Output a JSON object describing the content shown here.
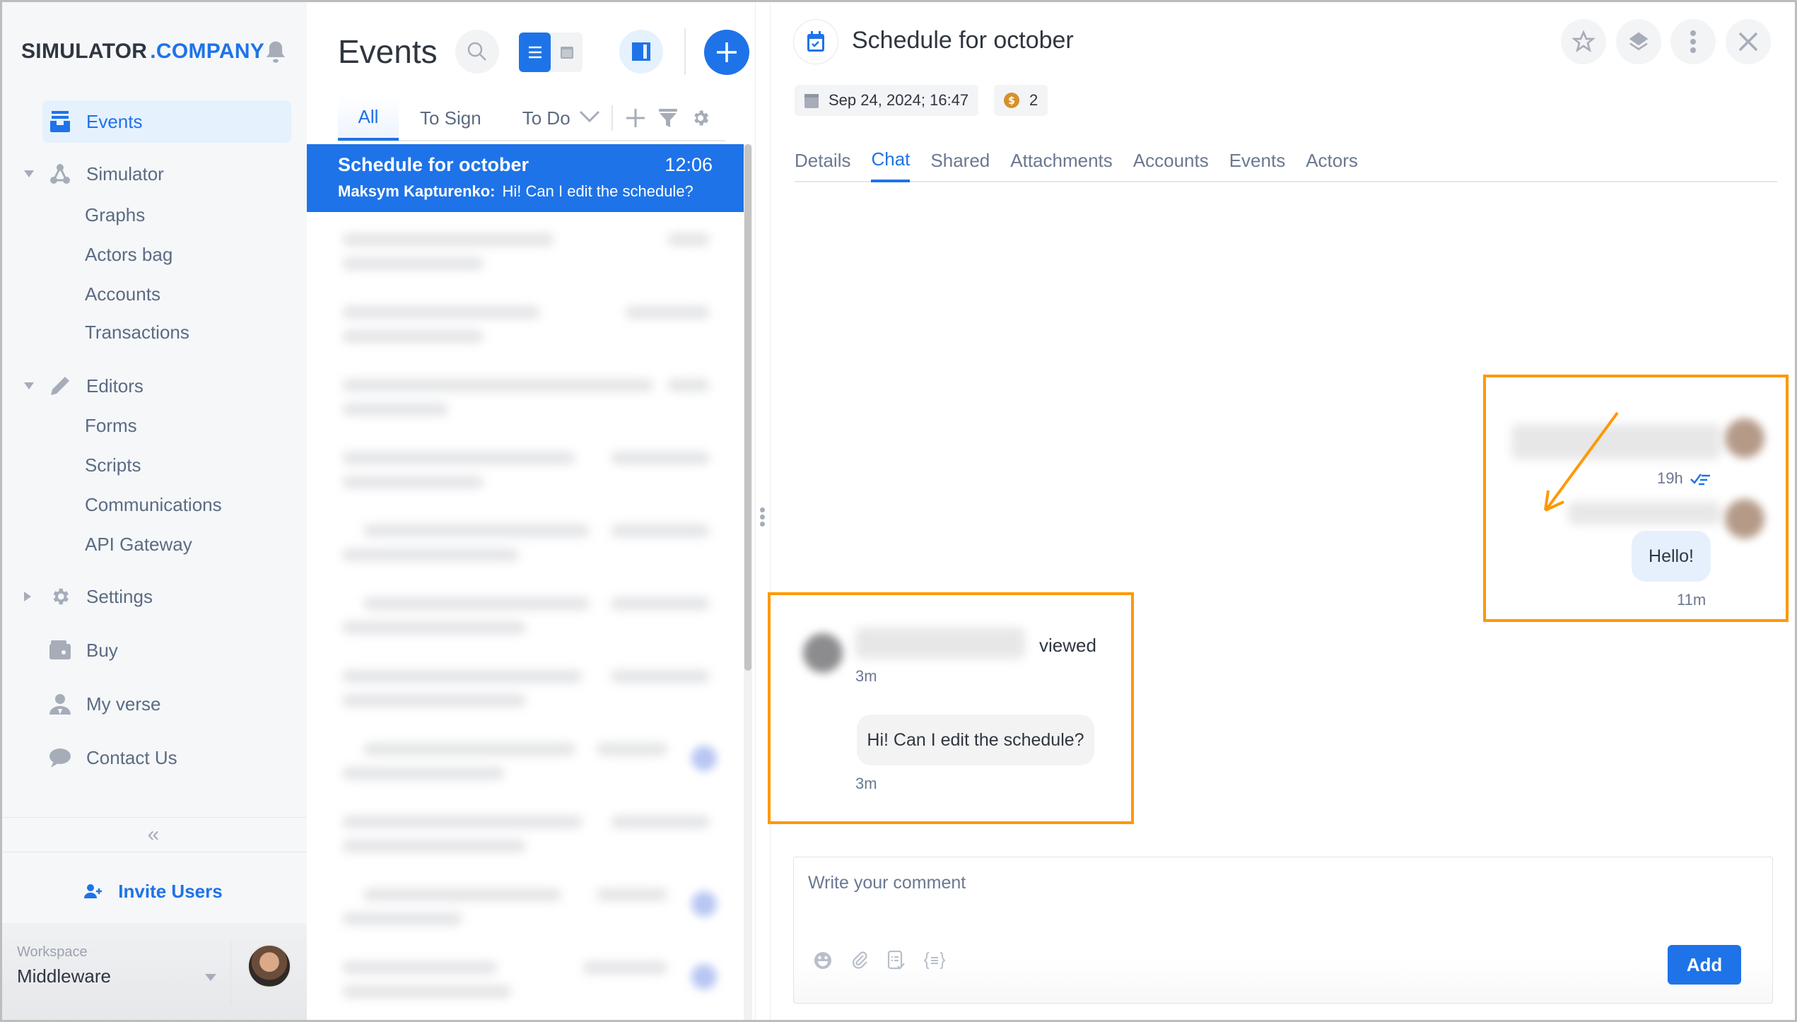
{
  "sidebar": {
    "brand": {
      "part1": "SIMULATOR",
      "part2": ".COMPANY"
    },
    "items": [
      {
        "label": "Events",
        "icon": "events-icon",
        "active": true
      },
      {
        "label": "Simulator",
        "icon": "graph-nodes-icon",
        "expanded": true
      },
      {
        "label": "Graphs"
      },
      {
        "label": "Actors bag"
      },
      {
        "label": "Accounts"
      },
      {
        "label": "Transactions"
      },
      {
        "label": "Editors",
        "icon": "pencil-icon",
        "expanded": true
      },
      {
        "label": "Forms"
      },
      {
        "label": "Scripts"
      },
      {
        "label": "Communications"
      },
      {
        "label": "API Gateway"
      },
      {
        "label": "Settings",
        "icon": "gear-icon",
        "expanded": false
      },
      {
        "label": "Buy",
        "icon": "wallet-icon"
      },
      {
        "label": "My verse",
        "icon": "user-icon"
      },
      {
        "label": "Contact Us",
        "icon": "chat-bubble-icon"
      }
    ],
    "collapse": "«",
    "invite_label": "Invite Users",
    "workspace": {
      "label": "Workspace",
      "value": "Middleware"
    }
  },
  "events_panel": {
    "title": "Events",
    "tabs": [
      {
        "label": "All",
        "active": true
      },
      {
        "label": "To Sign"
      },
      {
        "label": "To Do"
      }
    ],
    "selected_item": {
      "title": "Schedule for october",
      "time": "12:06",
      "author": "Maksym Kapturenko:",
      "preview": "Hi! Can I edit the schedule?"
    },
    "blurred_items_count": 10
  },
  "detail": {
    "title": "Schedule for october",
    "date_chip": "Sep 24, 2024; 16:47",
    "coin_chip": "2",
    "tabs": [
      {
        "label": "Details"
      },
      {
        "label": "Chat",
        "active": true
      },
      {
        "label": "Shared"
      },
      {
        "label": "Attachments"
      },
      {
        "label": "Accounts"
      },
      {
        "label": "Events"
      },
      {
        "label": "Actors"
      }
    ],
    "chat": {
      "mine": [
        {
          "time": "19h",
          "read": true
        },
        {
          "text": "Hello!",
          "time": "11m"
        }
      ],
      "theirs": {
        "action": "viewed",
        "action_time": "3m",
        "message": "Hi! Can I edit the schedule?",
        "message_time": "3m"
      }
    },
    "comment": {
      "placeholder": "Write your comment",
      "value": "",
      "add_label": "Add"
    }
  },
  "colors": {
    "accent": "#1e73e8",
    "highlight": "#ff9800",
    "sidebar_bg": "#f5f7f9"
  }
}
